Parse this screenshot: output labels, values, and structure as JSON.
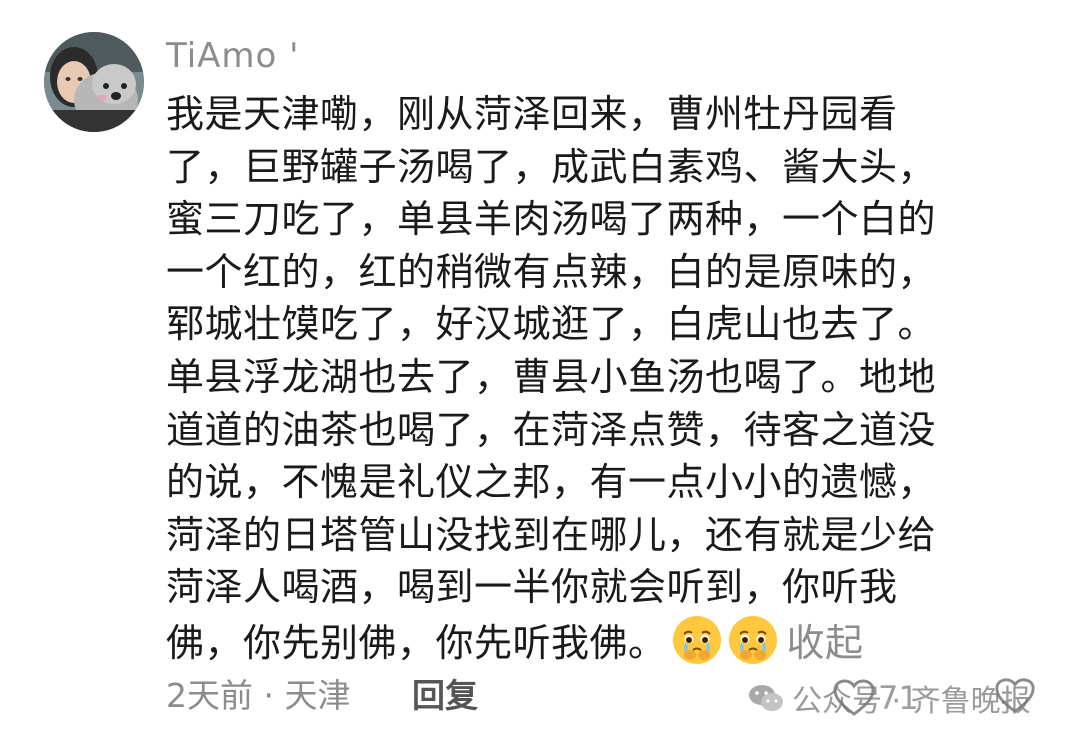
{
  "comment": {
    "username": "TiAmo '",
    "lines": [
      "我是天津嘞，刚从菏泽回来，曹州牡丹园看",
      "了，巨野罐子汤喝了，成武白素鸡、酱大头，",
      "蜜三刀吃了，单县羊肉汤喝了两种，一个白的",
      "一个红的，红的稍微有点辣，白的是原味的，",
      "郓城壮馍吃了，好汉城逛了，白虎山也去了。",
      "单县浮龙湖也去了，曹县小鱼汤也喝了。地地",
      "道道的油茶也喝了，在菏泽点赞，待客之道没",
      "的说，不愧是礼仪之邦，有一点小小的遗憾，",
      "菏泽的日塔管山没找到在哪儿，还有就是少给",
      "菏泽人喝酒，喝到一半你就会听到，你听我",
      "佛，你先别佛，你先听我佛。"
    ],
    "emojis": [
      "crying-face-emoji",
      "crying-face-emoji"
    ],
    "collapse_label": "收起",
    "meta": "2天前 · 天津",
    "reply_label": "回复",
    "like_count": "71",
    "watermark_text": "公众号 · 齐鲁晚报"
  },
  "colors": {
    "text": "#1a1a1a",
    "muted": "#8c8c8c",
    "emoji_yellow": "#ffc83d",
    "tear_blue": "#7fc4f2"
  }
}
